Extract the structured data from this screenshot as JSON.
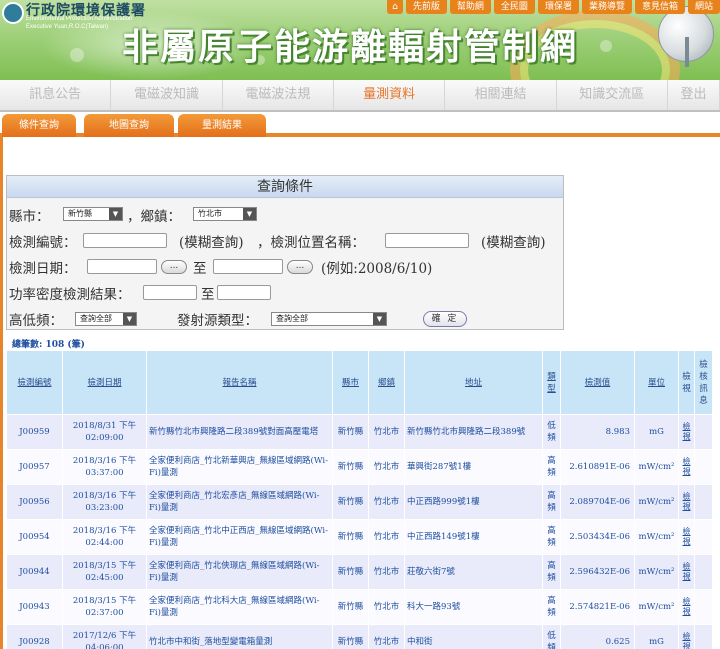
{
  "header": {
    "org_name": "行政院環境保護署",
    "org_en_1": "Environmental Protection Administration",
    "org_en_2": "Executive Yuan,R.O.C(Taiwan)",
    "site_title": "非屬原子能游離輻射管制網"
  },
  "top_links": [
    "先前版",
    "幫助網",
    "全民圖",
    "環保署",
    "業務導覽",
    "意見信箱",
    "網站"
  ],
  "main_nav": [
    "訊息公告",
    "電磁波知識",
    "電磁波法規",
    "量測資料",
    "相關連結",
    "知識交流區",
    "登出"
  ],
  "main_nav_active": 3,
  "sub_tabs": [
    "條件查詢",
    "地圖查詢",
    "量測結果"
  ],
  "query": {
    "title": "查詢條件",
    "county_label": "縣市：",
    "county_value": "新竹縣",
    "township_label": "，鄉鎮：",
    "township_value": "竹北市",
    "id_label": "檢測編號：",
    "fuzzy_1": "(模糊查詢)",
    "location_label": "，檢測位置名稱：",
    "fuzzy_2": "(模糊查詢)",
    "date_label": "檢測日期：",
    "date_to": "至",
    "date_example": "(例如:2008/6/10)",
    "power_label": "功率密度檢測結果：",
    "power_to": "至",
    "freq_label": "高低頻：",
    "freq_value": "查詢全部",
    "source_label": "發射源類型：",
    "source_value": "查詢全部",
    "submit_label": "確 定",
    "picker_label": "..."
  },
  "total": "總筆數: 108 (筆)",
  "table": {
    "headers": [
      "檢測編號",
      "檢測日期",
      "報告名稱",
      "縣市",
      "鄉鎮",
      "地址",
      "類型",
      "檢測值",
      "單位",
      "檢視",
      "檢核訊息"
    ],
    "rows": [
      {
        "id": "J00959",
        "date": "2018/8/31 下午 02:09:00",
        "name": "新竹縣竹北市興隆路二段389號對面高壓電塔",
        "county": "新竹縣",
        "town": "竹北市",
        "address": "新竹縣竹北市興隆路二段389號",
        "type": "低頻",
        "value": "8.983",
        "unit": "mG",
        "view": "檢視"
      },
      {
        "id": "J00957",
        "date": "2018/3/16 下午 03:37:00",
        "name": "全家便利商店_竹北新華興店_無線區域網路(Wi-Fi)量測",
        "county": "新竹縣",
        "town": "竹北市",
        "address": "華興街287號1樓",
        "type": "高頻",
        "value": "2.610891E-06",
        "unit": "mW/cm²",
        "view": "檢視"
      },
      {
        "id": "J00956",
        "date": "2018/3/16 下午 03:23:00",
        "name": "全家便利商店_竹北宏彥店_無線區域網路(Wi-Fi)量測",
        "county": "新竹縣",
        "town": "竹北市",
        "address": "中正西路999號1樓",
        "type": "高頻",
        "value": "2.089704E-06",
        "unit": "mW/cm²",
        "view": "檢視"
      },
      {
        "id": "J00954",
        "date": "2018/3/16 下午 02:44:00",
        "name": "全家便利商店_竹北中正西店_無線區域網路(Wi-Fi)量測",
        "county": "新竹縣",
        "town": "竹北市",
        "address": "中正西路149號1樓",
        "type": "高頻",
        "value": "2.503434E-06",
        "unit": "mW/cm²",
        "view": "檢視"
      },
      {
        "id": "J00944",
        "date": "2018/3/15 下午 02:45:00",
        "name": "全家便利商店_竹北俠璟店_無線區域網路(Wi-Fi)量測",
        "county": "新竹縣",
        "town": "竹北市",
        "address": "莊敬六街7號",
        "type": "高頻",
        "value": "2.596432E-06",
        "unit": "mW/cm²",
        "view": "檢視"
      },
      {
        "id": "J00943",
        "date": "2018/3/15 下午 02:37:00",
        "name": "全家便利商店_竹北科大店_無線區域網路(Wi-Fi)量測",
        "county": "新竹縣",
        "town": "竹北市",
        "address": "科大一路93號",
        "type": "高頻",
        "value": "2.574821E-06",
        "unit": "mW/cm²",
        "view": "檢視"
      },
      {
        "id": "J00928",
        "date": "2017/12/6 下午 04:06:00",
        "name": "竹北市中和街_落地型變電箱量測",
        "county": "新竹縣",
        "town": "竹北市",
        "address": "中和街",
        "type": "低頻",
        "value": "0.625",
        "unit": "mG",
        "view": "檢視"
      }
    ]
  },
  "colors": {
    "accent_orange": "#e8842a",
    "header_green": "#8fc866",
    "table_header_blue": "#c8e4f7",
    "link_blue": "#1f4fa0"
  }
}
